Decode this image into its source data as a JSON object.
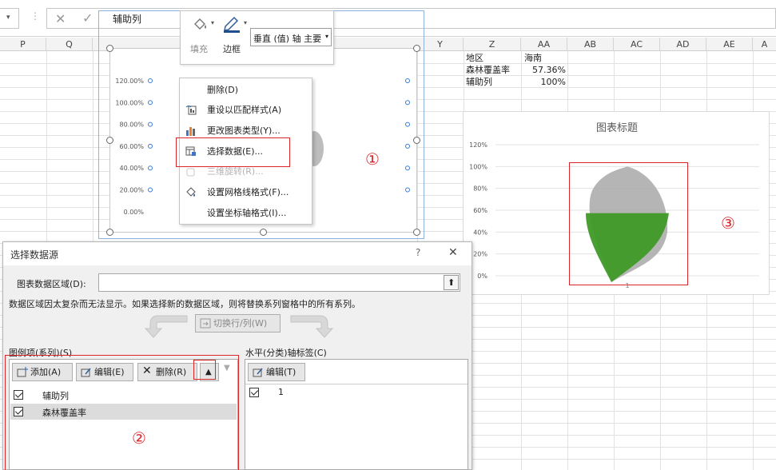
{
  "formula_bar": {
    "cancel_icon": "✕",
    "confirm_icon": "✓",
    "value": "辅助列"
  },
  "columns": [
    "P",
    "Q",
    "Y",
    "Z",
    "AA",
    "AB",
    "AC",
    "AD",
    "AE",
    "A"
  ],
  "cells": {
    "z1": "地区",
    "aa1": "海南",
    "z2": "森林覆盖率",
    "aa2": "57.36%",
    "z3": "辅助列",
    "aa3": "100%"
  },
  "minibar": {
    "fill_label": "填充",
    "border_label": "边框",
    "axis_select": "垂直 (值) 轴 主要"
  },
  "context_menu": {
    "items": [
      {
        "label": "删除(D)"
      },
      {
        "label": "重设以匹配样式(A)"
      },
      {
        "label": "更改图表类型(Y)..."
      },
      {
        "label": "选择数据(E)..."
      },
      {
        "label": "三维旋转(R)..."
      },
      {
        "label": "设置网格线格式(F)..."
      },
      {
        "label": "设置坐标轴格式(I)..."
      }
    ]
  },
  "annotations": {
    "one": "①",
    "two": "②",
    "three": "③"
  },
  "left_chart": {
    "ticks": [
      "120.00%",
      "100.00%",
      "80.00%",
      "60.00%",
      "40.00%",
      "20.00%",
      "0.00%"
    ]
  },
  "chart_data": [
    {
      "type": "bar",
      "title": "图表标题",
      "categories": [
        "1"
      ],
      "series": [
        {
          "name": "辅助列",
          "values": [
            100
          ]
        },
        {
          "name": "森林覆盖率",
          "values": [
            57.36
          ]
        }
      ],
      "ylim": [
        0,
        120
      ],
      "yticks": [
        "120%",
        "100%",
        "80%",
        "60%",
        "40%",
        "20%",
        "0%"
      ],
      "grid": true,
      "colors": {
        "辅助列": "#a8a8a8",
        "森林覆盖率": "#3f9a26"
      }
    }
  ],
  "dialog": {
    "title": "选择数据源",
    "help": "?",
    "close": "✕",
    "range_label": "图表数据区域(D):",
    "range_value": "",
    "info": "数据区域因太复杂而无法显示。如果选择新的数据区域，则将替换系列窗格中的所有系列。",
    "switch_label": "切换行/列(W)",
    "legend_title": "图例项(系列)(S)",
    "add_label": "添加(A)",
    "edit_label": "编辑(E)",
    "delete_label": "删除(R)",
    "series": [
      {
        "name": "辅助列",
        "checked": true
      },
      {
        "name": "森林覆盖率",
        "checked": true
      }
    ],
    "axis_title": "水平(分类)轴标签(C)",
    "axis_edit_label": "编辑(T)",
    "axis_items": [
      {
        "name": "1",
        "checked": true
      }
    ]
  }
}
